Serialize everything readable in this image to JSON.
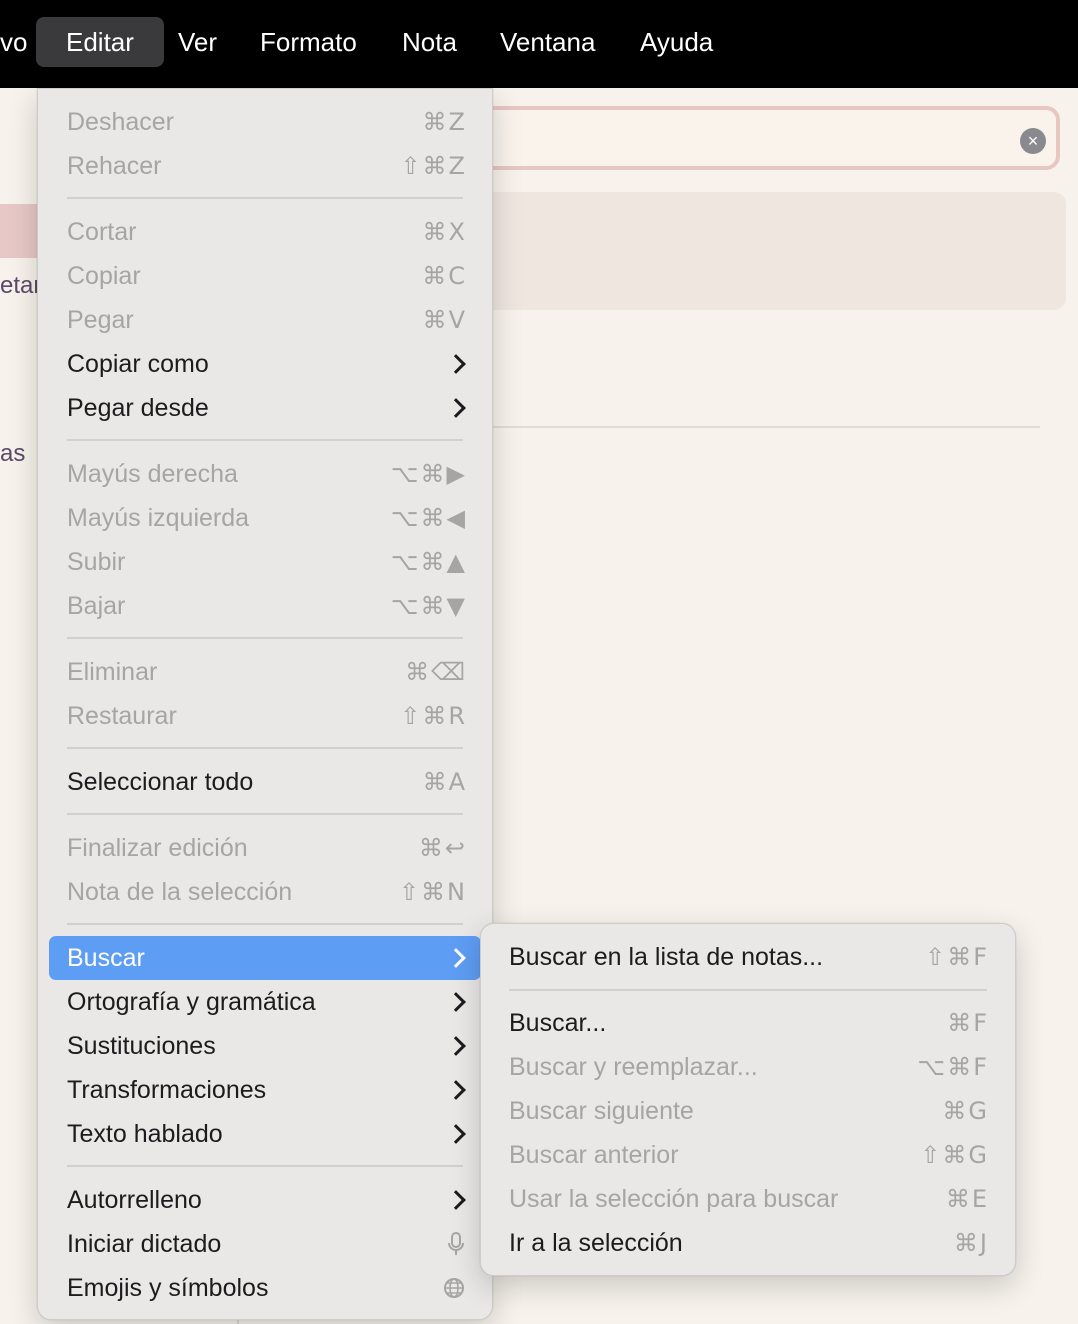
{
  "menubar": {
    "items": [
      "vo",
      "Editar",
      "Ver",
      "Formato",
      "Nota",
      "Ventana",
      "Ayuda"
    ]
  },
  "background": {
    "sidebar_texts": [
      "etar",
      "as"
    ],
    "clear_icon": "×"
  },
  "edit_menu": {
    "items": [
      {
        "label": "Deshacer",
        "shortcut": "⌘Z",
        "enabled": false
      },
      {
        "label": "Rehacer",
        "shortcut": "⇧⌘Z",
        "enabled": false
      },
      {
        "label": "Cortar",
        "shortcut": "⌘X",
        "enabled": false
      },
      {
        "label": "Copiar",
        "shortcut": "⌘C",
        "enabled": false
      },
      {
        "label": "Pegar",
        "shortcut": "⌘V",
        "enabled": false
      },
      {
        "label": "Copiar como",
        "submenu": true,
        "enabled": true
      },
      {
        "label": "Pegar desde",
        "submenu": true,
        "enabled": true
      },
      {
        "label": "Mayús derecha",
        "shortcut": "⌥⌘▶",
        "enabled": false
      },
      {
        "label": "Mayús izquierda",
        "shortcut": "⌥⌘◀",
        "enabled": false
      },
      {
        "label": "Subir",
        "shortcut": "⌥⌘▲",
        "enabled": false
      },
      {
        "label": "Bajar",
        "shortcut": "⌥⌘▼",
        "enabled": false
      },
      {
        "label": "Eliminar",
        "shortcut": "⌘⌫",
        "enabled": false
      },
      {
        "label": "Restaurar",
        "shortcut": "⇧⌘R",
        "enabled": false
      },
      {
        "label": "Seleccionar todo",
        "shortcut": "⌘A",
        "enabled": true
      },
      {
        "label": "Finalizar edición",
        "shortcut": "⌘↩",
        "enabled": false
      },
      {
        "label": "Nota de la selección",
        "shortcut": "⇧⌘N",
        "enabled": false
      },
      {
        "label": "Buscar",
        "submenu": true,
        "enabled": true,
        "highlighted": true
      },
      {
        "label": "Ortografía y gramática",
        "submenu": true,
        "enabled": true
      },
      {
        "label": "Sustituciones",
        "submenu": true,
        "enabled": true
      },
      {
        "label": "Transformaciones",
        "submenu": true,
        "enabled": true
      },
      {
        "label": "Texto hablado",
        "submenu": true,
        "enabled": true
      },
      {
        "label": "Autorrelleno",
        "submenu": true,
        "enabled": true
      },
      {
        "label": "Iniciar dictado",
        "icon": "microphone-icon",
        "enabled": true
      },
      {
        "label": "Emojis y símbolos",
        "icon": "globe-icon",
        "enabled": true
      }
    ]
  },
  "find_menu": {
    "items": [
      {
        "label": "Buscar en la lista de notas...",
        "shortcut": "⇧⌘F",
        "enabled": true
      },
      {
        "label": "Buscar...",
        "shortcut": "⌘F",
        "enabled": true
      },
      {
        "label": "Buscar y reemplazar...",
        "shortcut": "⌥⌘F",
        "enabled": false
      },
      {
        "label": "Buscar siguiente",
        "shortcut": "⌘G",
        "enabled": false
      },
      {
        "label": "Buscar anterior",
        "shortcut": "⇧⌘G",
        "enabled": false
      },
      {
        "label": "Usar la selección para buscar",
        "shortcut": "⌘E",
        "enabled": false
      },
      {
        "label": "Ir a la selección",
        "shortcut": "⌘J",
        "enabled": true
      }
    ]
  },
  "colors": {
    "highlight": "#5e9df4",
    "menu_bg": "#e9e8e6",
    "app_bg": "#f7f2ec",
    "search_border": "#e8c6c1"
  }
}
